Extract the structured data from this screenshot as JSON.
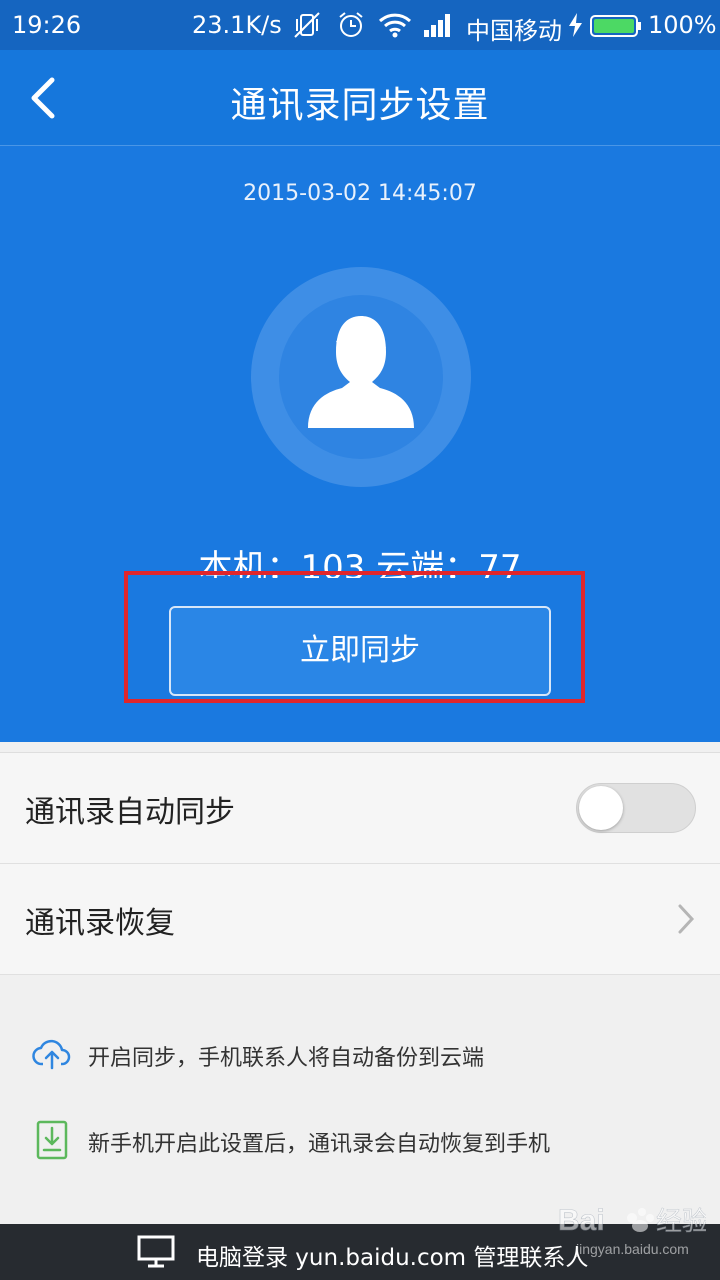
{
  "status_bar": {
    "time": "19:26",
    "net_speed": "23.1K/s",
    "carrier": "中国移动",
    "battery": "100%"
  },
  "header": {
    "title": "通讯录同步设置",
    "sync_time": "2015-03-02  14:45:07",
    "counts": "本机：103  云端：77",
    "sync_button": "立即同步"
  },
  "settings": {
    "auto_sync_label": "通讯录自动同步",
    "auto_sync_enabled": false,
    "restore_label": "通讯录恢复"
  },
  "tips": [
    {
      "icon": "cloud-upload-icon",
      "text": "开启同步，手机联系人将自动备份到云端"
    },
    {
      "icon": "download-phone-icon",
      "text": "新手机开启此设置后，通讯录会自动恢复到手机"
    }
  ],
  "bottom_bar": {
    "text": "电脑登录 yun.baidu.com 管理联系人"
  },
  "watermark": {
    "brand": "Baidu经验",
    "url": "jingyan.baidu.com"
  },
  "colors": {
    "header_blue": "#1a79e0",
    "highlight_red": "#e0262c",
    "tip_icon_blue": "#2f86e0",
    "tip_icon_green": "#5cb85c"
  }
}
